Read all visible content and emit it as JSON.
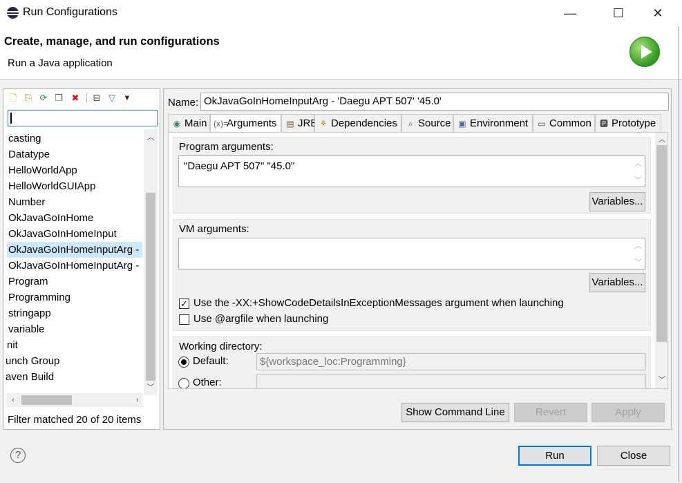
{
  "window": {
    "title": "Run Configurations",
    "minimize": "—",
    "maximize": "☐",
    "close": "✕"
  },
  "banner": {
    "heading": "Create, manage, and run configurations",
    "subheading": "Run a Java application"
  },
  "left": {
    "filter_value": "",
    "items": [
      "casting",
      "Datatype",
      "HelloWorldApp",
      "HelloWorldGUIApp",
      "Number",
      "OkJavaGoInHome",
      "OkJavaGoInHomeInput",
      "OkJavaGoInHomeInputArg -",
      "OkJavaGoInHomeInputArg -",
      "Program",
      "Programming",
      "stringapp",
      "variable",
      "nit",
      "unch Group",
      "aven Build"
    ],
    "selected_index": 7,
    "status": "Filter matched 20 of 20 items"
  },
  "right": {
    "name_label": "Name:",
    "name_value": "OkJavaGoInHomeInputArg - 'Daegu APT 507' '45.0'",
    "tabs": [
      {
        "label": "Main",
        "icon": "main-tab-icon"
      },
      {
        "label": "Arguments",
        "icon": "arguments-tab-icon"
      },
      {
        "label": "JRE",
        "icon": "jre-tab-icon"
      },
      {
        "label": "Dependencies",
        "icon": "dependencies-tab-icon"
      },
      {
        "label": "Source",
        "icon": "source-tab-icon"
      },
      {
        "label": "Environment",
        "icon": "environment-tab-icon"
      },
      {
        "label": "Common",
        "icon": "common-tab-icon"
      },
      {
        "label": "Prototype",
        "icon": "prototype-tab-icon"
      }
    ],
    "active_tab": "Arguments",
    "program_args_label": "Program arguments:",
    "program_args_value": "\"Daegu APT 507\" \"45.0\"",
    "vm_args_label": "VM arguments:",
    "vm_args_value": "",
    "variables_label": "Variables...",
    "show_code_details_label": "Use the -XX:+ShowCodeDetailsInExceptionMessages argument when launching",
    "show_code_details_checked": true,
    "argfile_label": "Use @argfile when launching",
    "argfile_checked": false,
    "workdir_label": "Working directory:",
    "default_label": "Default:",
    "default_value": "${workspace_loc:Programming}",
    "other_label": "Other:",
    "other_value": "",
    "show_command_line": "Show Command Line",
    "revert": "Revert",
    "apply": "Apply"
  },
  "footer": {
    "run": "Run",
    "close": "Close"
  }
}
